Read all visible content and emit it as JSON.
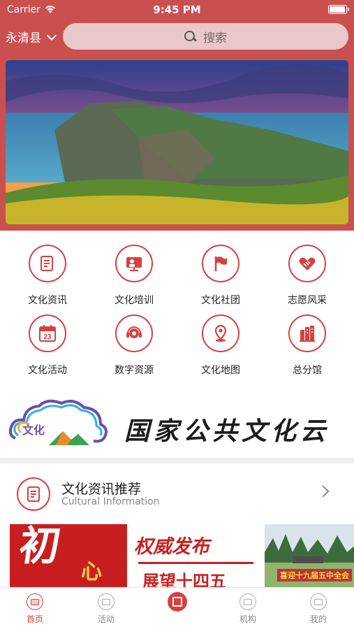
{
  "status_bar": {
    "carrier": "Carrier",
    "time": "9:45 PM",
    "battery_percent": 100
  },
  "header": {
    "location": "永清县",
    "search_placeholder": "搜索"
  },
  "banner": {
    "image": "coastal-cliff-sunset-photo"
  },
  "grid": [
    {
      "label": "文化资讯",
      "icon": "news-icon"
    },
    {
      "label": "文化培训",
      "icon": "training-icon"
    },
    {
      "label": "文化社团",
      "icon": "flag-icon"
    },
    {
      "label": "志愿风采",
      "icon": "handshake-icon"
    },
    {
      "label": "文化活动",
      "icon": "calendar-icon"
    },
    {
      "label": "数字资源",
      "icon": "headset-icon"
    },
    {
      "label": "文化地图",
      "icon": "map-pin-icon"
    },
    {
      "label": "总分馆",
      "icon": "library-icon"
    }
  ],
  "calendar_day": "23",
  "culture_cloud": {
    "logo_text": "文化",
    "title": "国家公共文化云"
  },
  "section": {
    "title": "文化资讯推荐",
    "subtitle": "Cultural Information"
  },
  "thumbs": [
    {
      "big": "初",
      "small": "心"
    },
    {
      "line1": "权威发布",
      "line2": "展望十四五"
    },
    {
      "caption": "喜迎十九届五中全会"
    }
  ],
  "tabs": [
    {
      "label": "首页",
      "active": true
    },
    {
      "label": "活动",
      "active": false
    },
    {
      "label": "",
      "active": false
    },
    {
      "label": "机构",
      "active": false
    },
    {
      "label": "我的",
      "active": false
    }
  ],
  "colors": {
    "brand": "#c9504f",
    "accent": "#d6413f"
  }
}
